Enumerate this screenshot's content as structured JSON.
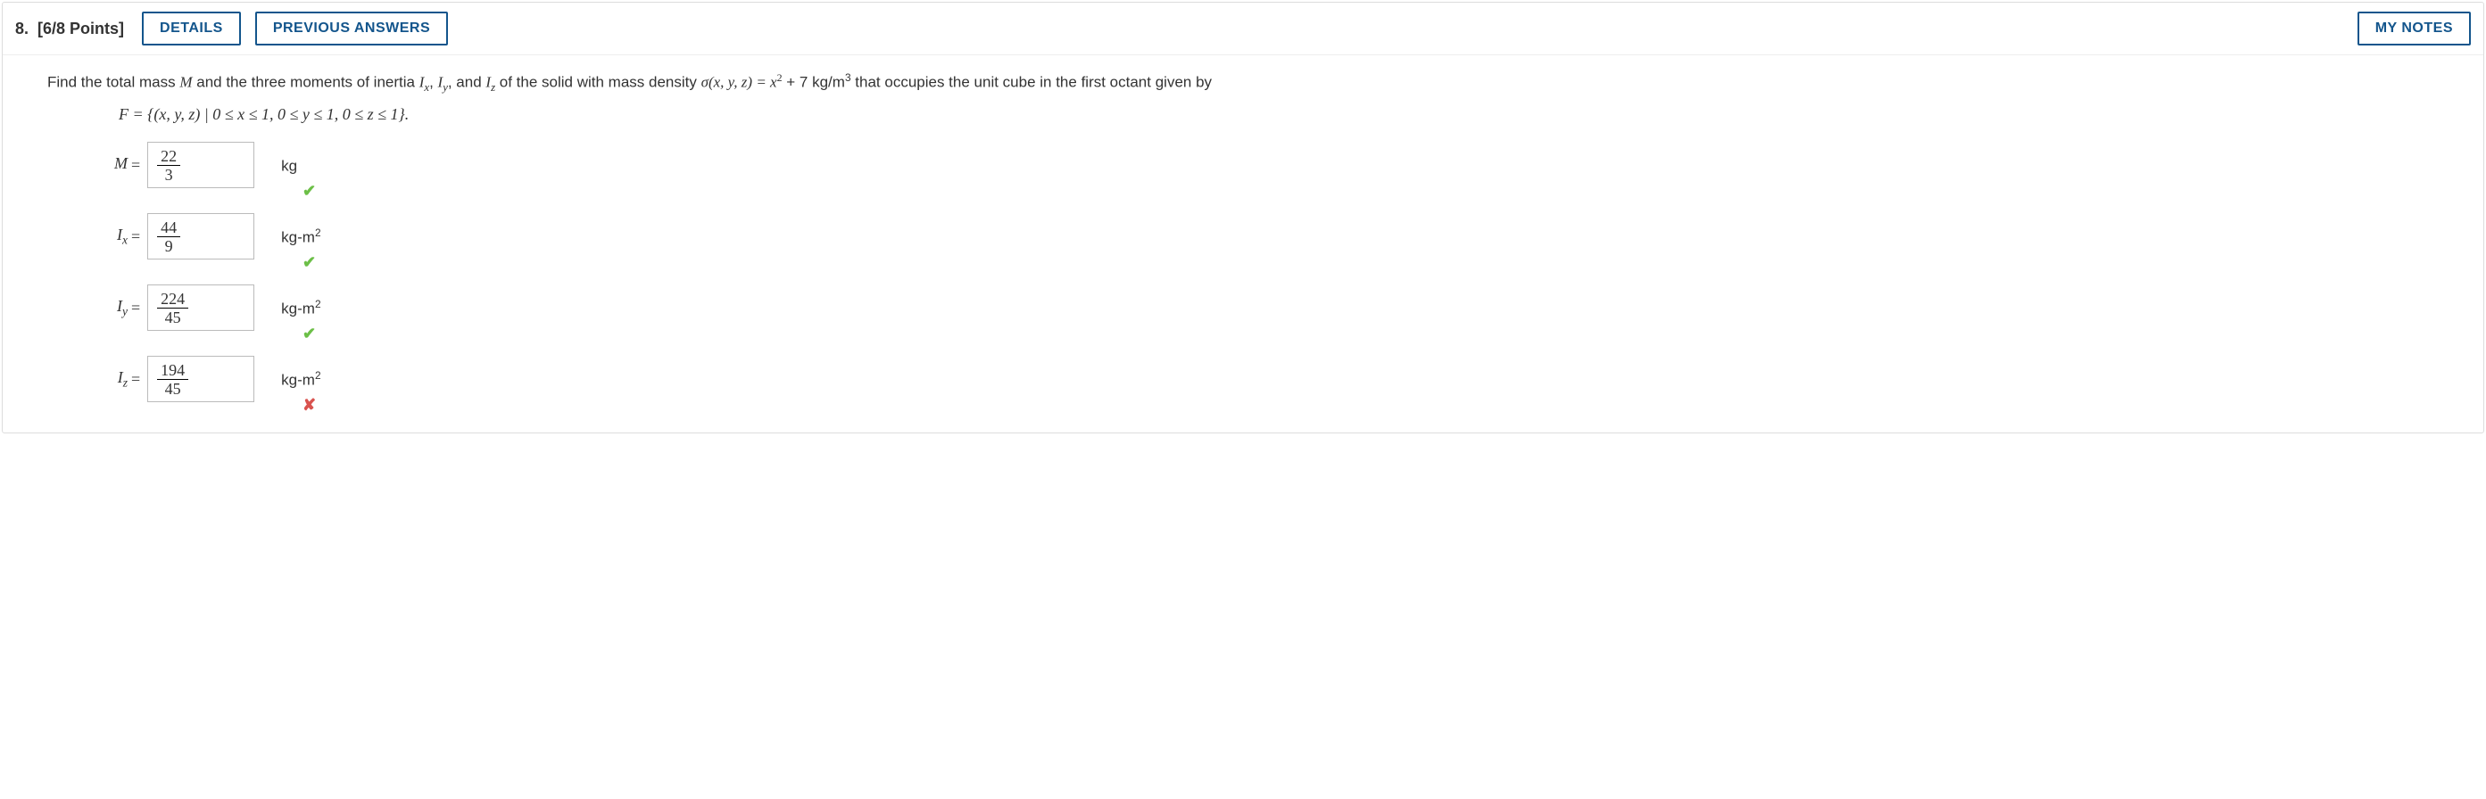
{
  "header": {
    "qnum": "8.",
    "points": "[6/8 Points]",
    "details": "DETAILS",
    "previous": "PREVIOUS ANSWERS",
    "mynotes": "MY NOTES"
  },
  "prompt": {
    "p1": "Find the total mass ",
    "M": "M",
    "p2": " and the three moments of inertia ",
    "Ix": "I",
    "Ix_sub": "x",
    "comma1": ", ",
    "Iy": "I",
    "Iy_sub": "y",
    "comma2": ", and ",
    "Iz": "I",
    "Iz_sub": "z",
    "p3": " of the solid with mass density ",
    "sigma": "σ(x, y, z) = x",
    "sq": "2",
    "p4": " + 7 kg/m",
    "cube": "3",
    "p5": " that occupies the unit cube in the first octant given by"
  },
  "setdef": "F = {(x, y, z) | 0 ≤ x ≤ 1, 0 ≤ y ≤ 1, 0 ≤ z ≤ 1}.",
  "answers": [
    {
      "label_var": "M",
      "label_sub": "",
      "num": "22",
      "den": "3",
      "unit": "kg",
      "unit_sup": "",
      "mark": "correct"
    },
    {
      "label_var": "I",
      "label_sub": "x",
      "num": "44",
      "den": "9",
      "unit": "kg-m",
      "unit_sup": "2",
      "mark": "correct"
    },
    {
      "label_var": "I",
      "label_sub": "y",
      "num": "224",
      "den": "45",
      "unit": "kg-m",
      "unit_sup": "2",
      "mark": "correct"
    },
    {
      "label_var": "I",
      "label_sub": "z",
      "num": "194",
      "den": "45",
      "unit": "kg-m",
      "unit_sup": "2",
      "mark": "wrong"
    }
  ],
  "marks": {
    "correct": "✔",
    "wrong": "✘"
  }
}
